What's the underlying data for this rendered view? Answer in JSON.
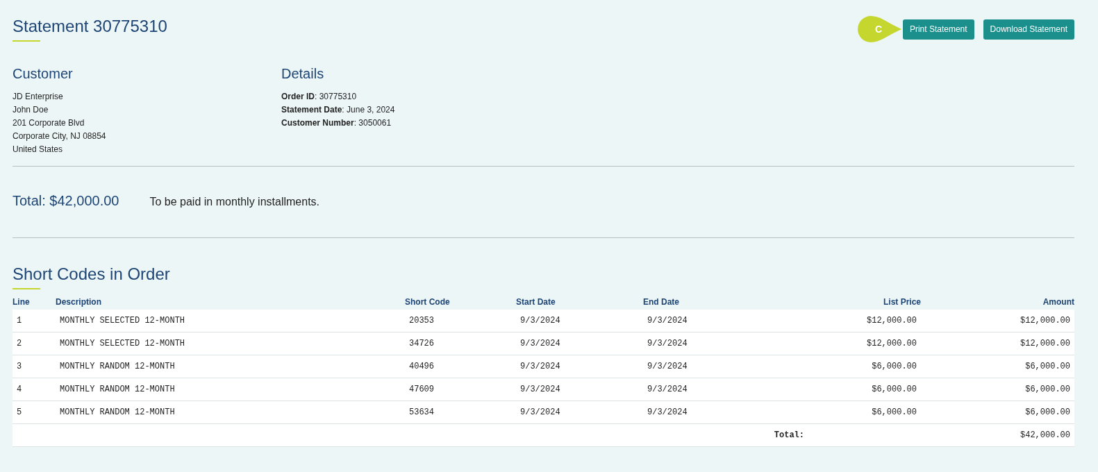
{
  "header": {
    "title": "Statement 30775310",
    "callout": "C",
    "buttons": [
      {
        "label": "Print Statement"
      },
      {
        "label": "Download Statement"
      }
    ]
  },
  "customer": {
    "heading": "Customer",
    "lines": [
      "JD Enterprise",
      "John Doe",
      "201 Corporate Blvd",
      "Corporate City, NJ 08854",
      "United States"
    ]
  },
  "details": {
    "heading": "Details",
    "lines": [
      "**Order ID**: 30775310",
      "**Statement Date**: June 3, 2024",
      "**Customer Number**: 3050061"
    ]
  },
  "summary": {
    "total": "Total: $42,000.00",
    "note": "To be paid in monthly installments."
  },
  "short_codes": {
    "heading": "Short Codes in Order",
    "columns": [
      "Line",
      "Description",
      "Short Code",
      "Start Date",
      "End Date",
      "List Price",
      "Amount"
    ],
    "rows": [
      [
        "1",
        "MONTHLY SELECTED 12-MONTH",
        "20353",
        "9/3/2024",
        "9/3/2024",
        "$12,000.00",
        "$12,000.00"
      ],
      [
        "2",
        "MONTHLY SELECTED 12-MONTH",
        "34726",
        "9/3/2024",
        "9/3/2024",
        "$12,000.00",
        "$12,000.00"
      ],
      [
        "3",
        "MONTHLY RANDOM 12-MONTH",
        "40496",
        "9/3/2024",
        "9/3/2024",
        "$6,000.00",
        "$6,000.00"
      ],
      [
        "4",
        "MONTHLY RANDOM 12-MONTH",
        "47609",
        "9/3/2024",
        "9/3/2024",
        "$6,000.00",
        "$6,000.00"
      ],
      [
        "5",
        "MONTHLY RANDOM 12-MONTH",
        "53634",
        "9/3/2024",
        "9/3/2024",
        "$6,000.00",
        "$6,000.00"
      ]
    ],
    "footer": {
      "label": "Total:",
      "amount": "$42,000.00"
    }
  }
}
